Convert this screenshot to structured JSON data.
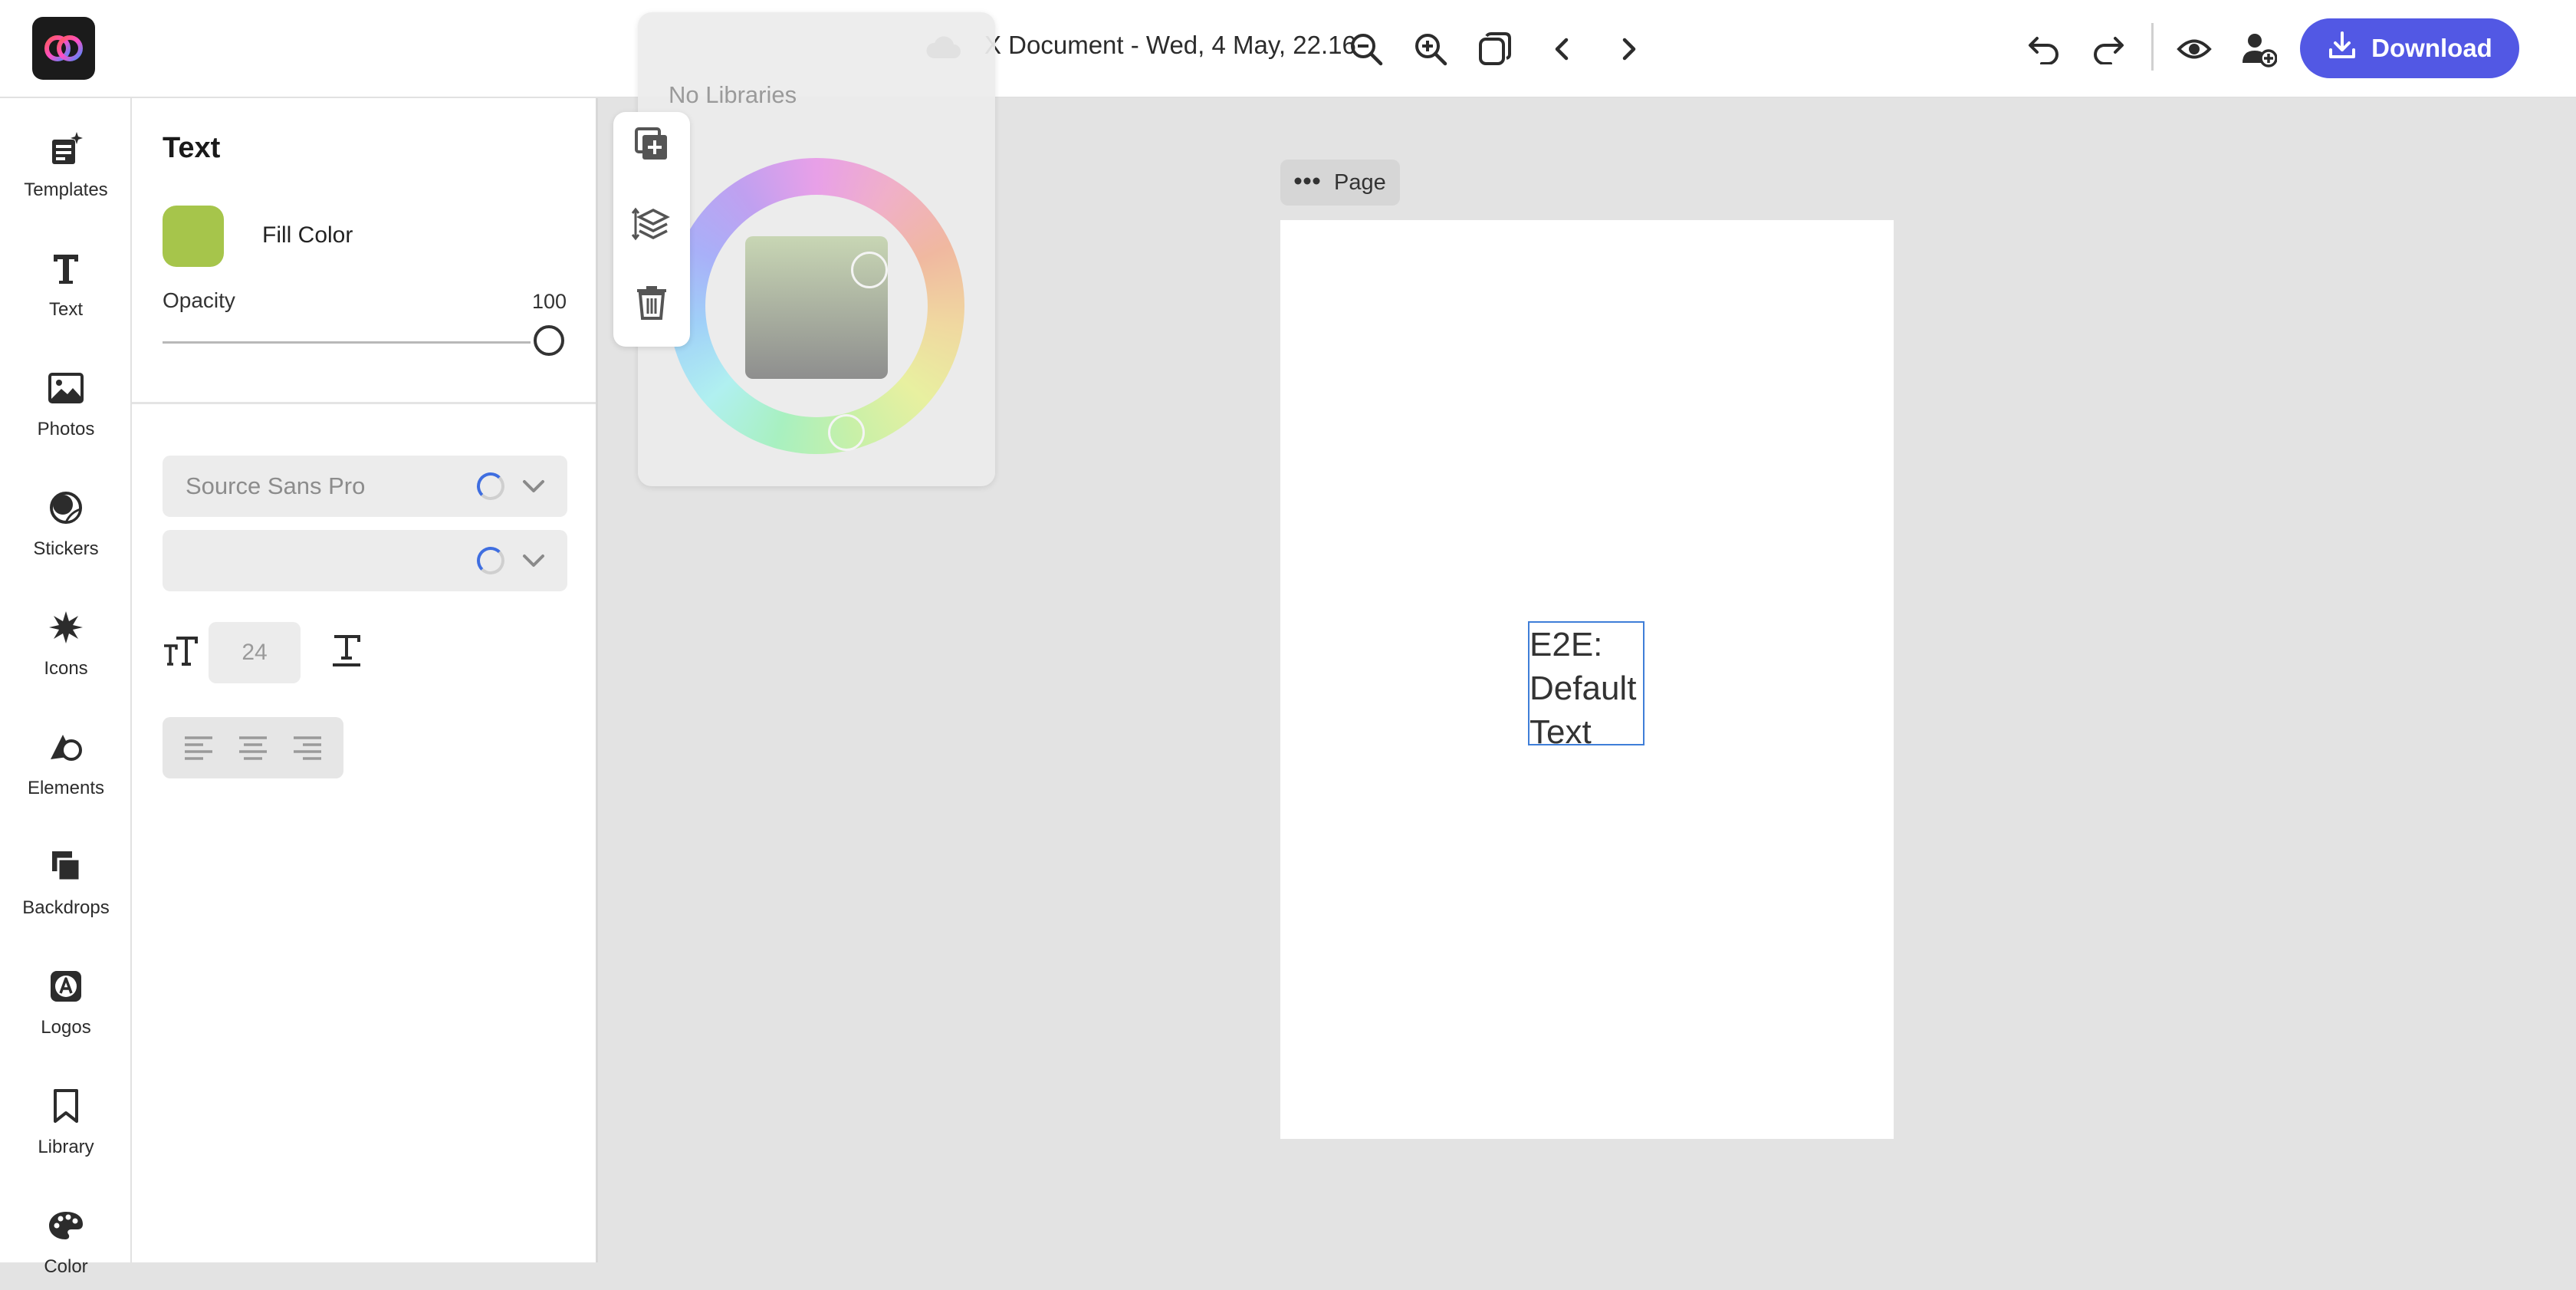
{
  "header": {
    "document_title": "X Document - Wed, 4 May, 22.16",
    "download_label": "Download",
    "icons": [
      "app-logo",
      "cloud-icon",
      "zoom-out-icon",
      "zoom-in-icon",
      "pages-icon",
      "chevron-left-icon",
      "chevron-right-icon",
      "undo-icon",
      "redo-icon",
      "preview-icon",
      "share-icon",
      "download-icon"
    ],
    "accent_color": "#5258e4"
  },
  "sidebar": {
    "items": [
      {
        "label": "Templates",
        "icon": "templates-icon"
      },
      {
        "label": "Text",
        "icon": "text-icon"
      },
      {
        "label": "Photos",
        "icon": "photos-icon"
      },
      {
        "label": "Stickers",
        "icon": "stickers-icon"
      },
      {
        "label": "Icons",
        "icon": "icons-icon"
      },
      {
        "label": "Elements",
        "icon": "elements-icon"
      },
      {
        "label": "Backdrops",
        "icon": "backdrops-icon"
      },
      {
        "label": "Logos",
        "icon": "logos-icon"
      },
      {
        "label": "Library",
        "icon": "library-icon"
      },
      {
        "label": "Color",
        "icon": "palette-icon"
      }
    ]
  },
  "panel": {
    "title": "Text",
    "fill_label": "Fill Color",
    "fill_color": "#a6c54b",
    "opacity_label": "Opacity",
    "opacity_value": "100",
    "font_family": "Source Sans Pro",
    "font_style": "",
    "font_size": "24"
  },
  "color_picker": {
    "no_libraries": "No Libraries"
  },
  "canvas": {
    "page_label": "Page",
    "text_content": "E2E:\nDefault\nText",
    "selection_color": "#3f7ed8"
  }
}
